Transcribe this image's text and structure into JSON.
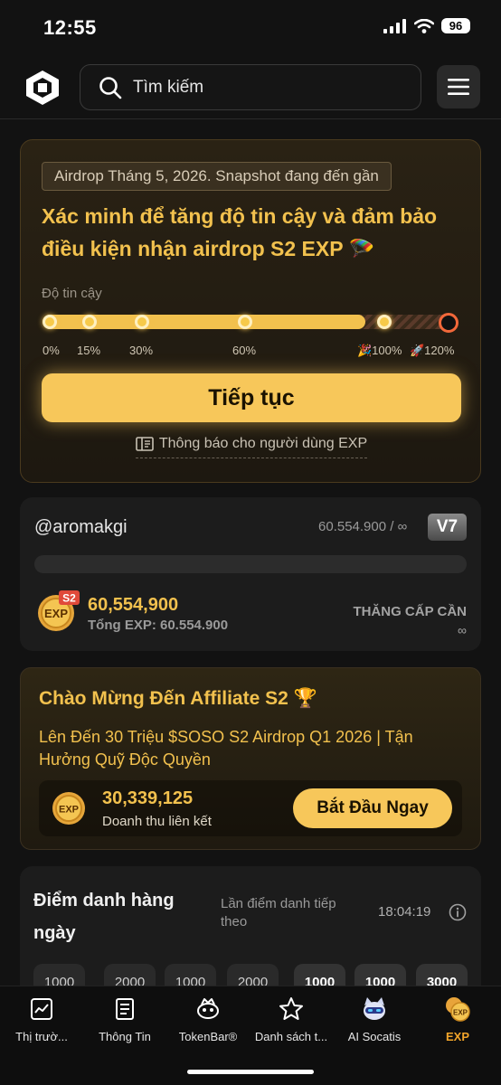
{
  "status_bar": {
    "time": "12:55",
    "battery": "96"
  },
  "header": {
    "search_placeholder": "Tìm kiếm"
  },
  "airdrop": {
    "chip": "Airdrop Tháng 5, 2026. Snapshot đang đến gần",
    "title": "Xác minh để tăng độ tin cậy và đảm bảo điều kiện nhận airdrop S2 EXP 🪂",
    "trust_label": "Độ tin cậy",
    "progress_percent": 100,
    "milestones": [
      "0%",
      "15%",
      "30%",
      "60%",
      "🎉100%",
      "🚀120%"
    ],
    "continue_label": "Tiếp tục",
    "notice_label": "Thông báo cho người dùng EXP"
  },
  "user": {
    "username": "@aromakgi",
    "exp_ratio": "60.554.900 / ∞",
    "vip_level": "V7",
    "season_badge": "S2",
    "coin_text": "EXP",
    "exp_amount": "60,554,900",
    "exp_total": "Tổng EXP: 60.554.900",
    "upgrade_label": "THĂNG CẤP CẦN",
    "upgrade_value": "∞"
  },
  "affiliate": {
    "title": "Chào Mừng Đến Affiliate S2 🏆",
    "description": "Lên Đến 30 Triệu $SOSO S2 Airdrop Q1 2026 | Tận Hưởng Quỹ Độc Quyền",
    "coin_text": "EXP",
    "amount": "30,339,125",
    "amount_label": "Doanh thu liên kết",
    "start_label": "Bắt Đầu Ngay"
  },
  "checkin": {
    "title": "Điểm danh hàng ngày",
    "next_label": "Lần điểm danh tiếp theo",
    "countdown": "18:04:19",
    "days": [
      "1000",
      "2000",
      "1000",
      "2000",
      "1000",
      "1000",
      "3000"
    ]
  },
  "tabs": [
    {
      "label": "Thị trườ...",
      "icon": "market-chart-icon"
    },
    {
      "label": "Thông Tin",
      "icon": "news-icon"
    },
    {
      "label": "TokenBar®",
      "icon": "tokenbar-icon"
    },
    {
      "label": "Danh sách t...",
      "icon": "star-icon"
    },
    {
      "label": "AI Socatis",
      "icon": "ai-cat-icon"
    },
    {
      "label": "EXP",
      "icon": "exp-icon",
      "active": true
    }
  ],
  "colors": {
    "accent": "#f2c14e",
    "button": "#f7c75a",
    "active_tab": "#f2a52a",
    "background": "#121212"
  }
}
